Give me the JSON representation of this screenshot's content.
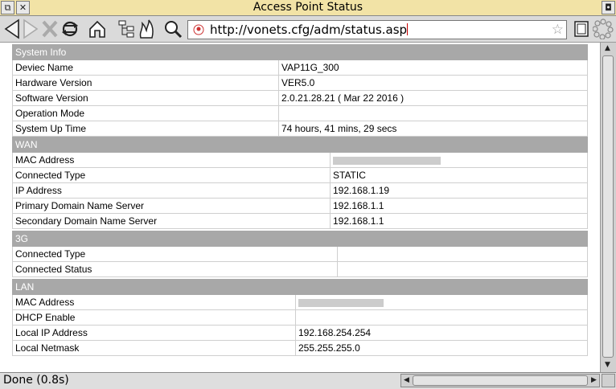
{
  "window": {
    "title": "Access Point Status",
    "url": "http://vonets.cfg/adm/status.asp"
  },
  "statusbar": {
    "text": "Done (0.8s)"
  },
  "sections": {
    "system": {
      "header": "System Info",
      "rows": [
        {
          "label": "Deviec Name",
          "value": "VAP11G_300"
        },
        {
          "label": "Hardware Version",
          "value": "VER5.0"
        },
        {
          "label": "Software Version",
          "value": "2.0.21.28.21 ( Mar 22 2016 )"
        },
        {
          "label": "Operation Mode",
          "value": ""
        },
        {
          "label": "System Up Time",
          "value": "74 hours, 41 mins, 29 secs"
        }
      ]
    },
    "wan": {
      "header": "WAN",
      "rows": [
        {
          "label": "MAC Address",
          "value": ""
        },
        {
          "label": "Connected Type",
          "value": "STATIC"
        },
        {
          "label": "IP Address",
          "value": "192.168.1.19"
        },
        {
          "label": "Primary Domain Name Server",
          "value": "192.168.1.1"
        },
        {
          "label": "Secondary Domain Name Server",
          "value": "192.168.1.1"
        }
      ]
    },
    "g3": {
      "header": "3G",
      "rows": [
        {
          "label": "Connected Type",
          "value": ""
        },
        {
          "label": "Connected Status",
          "value": ""
        }
      ]
    },
    "lan": {
      "header": "LAN",
      "rows": [
        {
          "label": "MAC Address",
          "value": ""
        },
        {
          "label": "DHCP Enable",
          "value": ""
        },
        {
          "label": "Local IP Address",
          "value": "192.168.254.254"
        },
        {
          "label": "Local Netmask",
          "value": "255.255.255.0"
        }
      ]
    }
  }
}
